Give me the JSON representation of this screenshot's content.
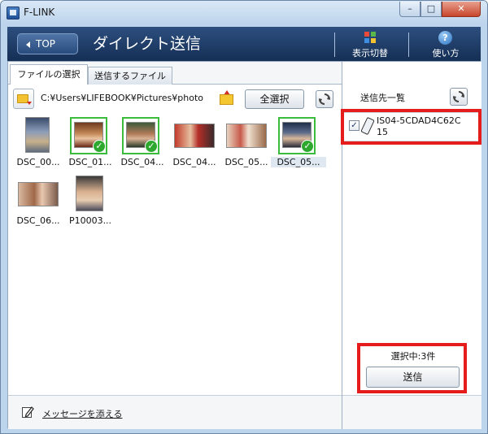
{
  "window": {
    "title": "F-LINK",
    "min_label": "–",
    "max_label": "□",
    "close_label": "✕"
  },
  "header": {
    "back_label": "TOP",
    "title": "ダイレクト送信",
    "view_toggle_label": "表示切替",
    "help_label": "使い方",
    "help_glyph": "?"
  },
  "tabs": [
    {
      "label": "ファイルの選択",
      "active": true
    },
    {
      "label": "送信するファイル",
      "active": false
    }
  ],
  "path": {
    "text": "C:¥Users¥LIFEBOOK¥Pictures¥photo",
    "select_all_label": "全選択"
  },
  "files": [
    {
      "name": "DSC_00...",
      "selected": false,
      "caption_highlight": false
    },
    {
      "name": "DSC_01...",
      "selected": true,
      "caption_highlight": false
    },
    {
      "name": "DSC_04...",
      "selected": true,
      "caption_highlight": false
    },
    {
      "name": "DSC_04...",
      "selected": false,
      "caption_highlight": false
    },
    {
      "name": "DSC_05...",
      "selected": false,
      "caption_highlight": false
    },
    {
      "name": "DSC_05...",
      "selected": true,
      "caption_highlight": true
    },
    {
      "name": "DSC_06...",
      "selected": false,
      "caption_highlight": false
    },
    {
      "name": "P10003...",
      "selected": false,
      "caption_highlight": false
    }
  ],
  "footer": {
    "message_label": "メッセージを添える"
  },
  "destinations": {
    "title": "送信先一覧",
    "items": [
      {
        "name": "IS04-5CDAD4C62C15",
        "checked": true
      }
    ]
  },
  "send": {
    "count_label": "選択中:3件",
    "send_label": "送信"
  },
  "colors": {
    "header_bg": "#1e3a63",
    "check_green": "#2ea82e",
    "highlight_red": "#e51c1c"
  },
  "icons": {
    "folder": "folder-icon",
    "refresh": "refresh-icon",
    "help": "help-icon",
    "view": "grid-icon",
    "pen": "pen-icon",
    "phone": "phone-icon"
  }
}
